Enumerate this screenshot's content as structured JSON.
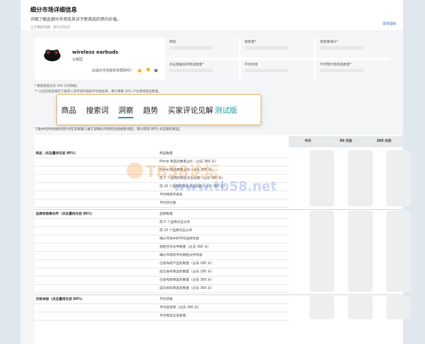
{
  "header": {
    "title": "细分市场详细信息",
    "subtitle": "详细了解此细分市场及其对于新商品的意向价值。",
    "updated": "上次更新日期：8/12/2023",
    "learn_link": "请求指标"
  },
  "product": {
    "name": "wireless earbuds",
    "brand": "云耀国",
    "feedback_question": "此提示市场看析有帮助吗？"
  },
  "metrics": [
    {
      "label": "商城"
    },
    {
      "label": "搜索量*"
    },
    {
      "label": "搜索量增长*"
    },
    {
      "label": "点击量最多的商品数量*"
    },
    {
      "label": "平均价格"
    },
    {
      "label": "平均预计的商品数量*"
    }
  ],
  "notes": [
    "* 数据基础过去 360 天的数据。",
    "** 以当前商品报告下类目入常市场的相关平均搜索率，要计算算 30% 产生事情商品数量。"
  ],
  "tabs": [
    "商品",
    "搜索词",
    "洞察",
    "趋势",
    "买家评论见解",
    "测试版"
  ],
  "section_desc": "下表中的所有指标均针对在买家输入属于该细分市场的任意搜索词后，累计获得 90% 点击量的商品。",
  "columns": [
    "今天",
    "90 天前",
    "360 天前"
  ],
  "groups": [
    {
      "name": "商品（点击量排名前 80%）",
      "rows": [
        "商品数量",
        "Prime 商品的数量占比（过去 360 天）",
        "Prime 商品数量占比（过去 360 天）",
        "前 5 个品牌的商品点击份额（过去 180 天）",
        "前 20 个品牌的商品点击份额（过去 360 天）",
        "平均畅销市排名",
        "平均评论数"
      ]
    },
    {
      "name": "品牌和销售伙伴（点击量排名前 80%）",
      "rows": [
        "品牌数量",
        "前 5 个品牌点击分享",
        "前 20 个品牌点击分享",
        "细分市场中的平均品牌年龄",
        "销售合作伙伴数量（过去 360 天）",
        "细分市场的平均销售伙伴年龄",
        "已发布新产品的数量（过去 180 天）",
        "成功发布商品的数量（过去 180 天）",
        "已发布新商品的数量（过去 360 天）",
        "成功发布商品的数量（过去 360 天）"
      ]
    },
    {
      "name": "买家体验（点击量排名前 80%）",
      "rows": [
        "平均评级",
        "平均退货率（过去 360 天）",
        "平均商品信息质量"
      ]
    }
  ],
  "watermark": {
    "top": "TB58论坛",
    "bottom": "www.tb58.net"
  }
}
